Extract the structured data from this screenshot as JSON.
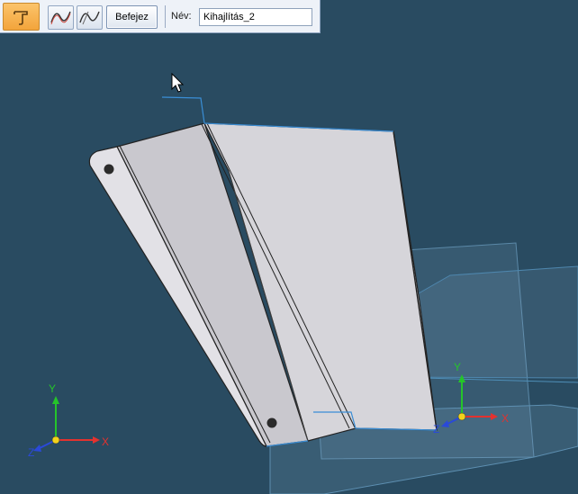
{
  "toolbar": {
    "main_step_icon": "hem-step-icon",
    "step_icons": [
      "curve-tool-icon",
      "curve-tool-alt-icon"
    ],
    "finish_label": "Befejez",
    "name_label": "Név:",
    "name_value": "Kihajlítás_2"
  },
  "viewport": {
    "triad_left": {
      "x_label": "X",
      "y_label": "Y",
      "z_label": "Z"
    },
    "triad_right": {
      "x_label": "X",
      "y_label": "Y",
      "z_label": "Z"
    }
  },
  "colors": {
    "background": "#294b61",
    "part_face": "#d6d5da",
    "axis_x": "#e3322f",
    "axis_y": "#25c42a",
    "axis_z": "#2a49d9",
    "origin": "#f2d21c",
    "plane": "#5a86a6"
  }
}
